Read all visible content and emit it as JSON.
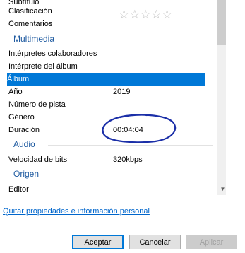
{
  "properties": {
    "partial_top_label": "Subtítulo",
    "rows_top": [
      {
        "label": "Clasificación",
        "value": ""
      },
      {
        "label": "Comentarios",
        "value": ""
      }
    ],
    "rating": {
      "stars_filled": 0,
      "stars_total": 5,
      "glyphs": "☆☆☆☆☆"
    },
    "sections": {
      "multimedia": "Multimedia",
      "audio": "Audio",
      "origen": "Origen"
    },
    "multimedia_rows": [
      {
        "label": "Intérpretes colaboradores",
        "value": ""
      },
      {
        "label": "Intérprete del álbum",
        "value": ""
      },
      {
        "label": "Álbum",
        "value": "",
        "selected": true
      },
      {
        "label": "Año",
        "value": "2019"
      },
      {
        "label": "Número de pista",
        "value": ""
      },
      {
        "label": "Género",
        "value": ""
      },
      {
        "label": "Duración",
        "value": "00:04:04"
      }
    ],
    "audio_rows": [
      {
        "label": "Velocidad de bits",
        "value": "320kbps"
      }
    ],
    "origen_rows": [
      {
        "label": "Editor",
        "value": ""
      }
    ]
  },
  "scrollbar": {
    "up_arrow": "▲",
    "down_arrow": "▼"
  },
  "footer_link": "Quitar propiedades e información personal",
  "buttons": {
    "accept": "Aceptar",
    "cancel": "Cancelar",
    "apply": "Aplicar"
  },
  "colors": {
    "selection": "#0078d7",
    "section_title": "#1e5aa0",
    "link": "#0066cc",
    "annotation": "#1b2fa8"
  }
}
